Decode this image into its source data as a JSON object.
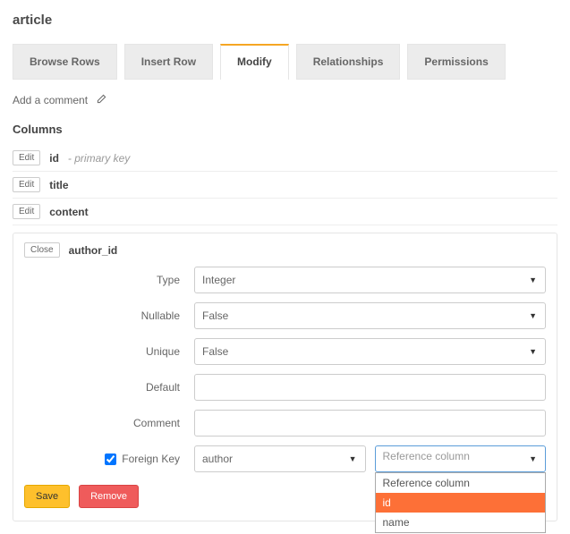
{
  "page": {
    "title": "article"
  },
  "tabs": {
    "items": [
      "Browse Rows",
      "Insert Row",
      "Modify",
      "Relationships",
      "Permissions"
    ],
    "active_index": 2
  },
  "comment": {
    "add_text": "Add a comment"
  },
  "columns": {
    "header": "Columns",
    "edit_label": "Edit",
    "close_label": "Close",
    "list": [
      {
        "name": "id",
        "note": "- primary key"
      },
      {
        "name": "title",
        "note": ""
      },
      {
        "name": "content",
        "note": ""
      }
    ],
    "expanded": {
      "name": "author_id",
      "form": {
        "type_label": "Type",
        "type_value": "Integer",
        "nullable_label": "Nullable",
        "nullable_value": "False",
        "unique_label": "Unique",
        "unique_value": "False",
        "default_label": "Default",
        "default_value": "",
        "comment_label": "Comment",
        "comment_value": "",
        "fk_label": "Foreign Key",
        "fk_checked": true,
        "fk_table": "author",
        "fk_ref_placeholder": "Reference column",
        "fk_ref_options": [
          "Reference column",
          "id",
          "name"
        ],
        "fk_ref_highlight_index": 1
      },
      "actions": {
        "save": "Save",
        "remove": "Remove"
      }
    }
  }
}
